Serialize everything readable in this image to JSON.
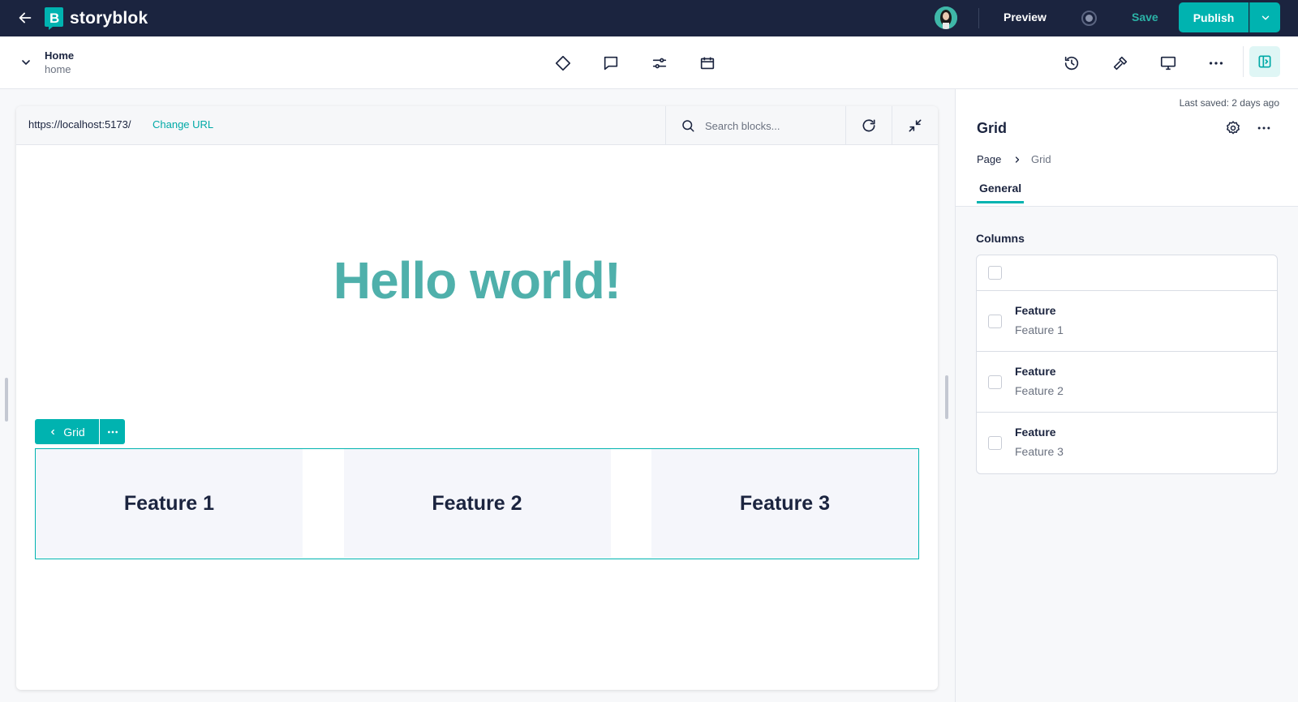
{
  "app": {
    "name": "storyblok"
  },
  "topbar": {
    "preview_label": "Preview",
    "save_label": "Save",
    "publish_label": "Publish"
  },
  "story": {
    "name": "Home",
    "slug": "home"
  },
  "urlbar": {
    "url": "https://localhost:5173/",
    "change_url_label": "Change URL",
    "search_placeholder": "Search blocks..."
  },
  "canvas": {
    "hero_title": "Hello world!",
    "grid_label": "Grid",
    "features": [
      "Feature 1",
      "Feature 2",
      "Feature 3"
    ]
  },
  "panel": {
    "last_saved": "Last saved: 2 days ago",
    "title": "Grid",
    "breadcrumb": [
      "Page",
      "Grid"
    ],
    "tab": "General",
    "columns_label": "Columns",
    "columns": [
      {
        "type": "Feature",
        "name": "Feature 1"
      },
      {
        "type": "Feature",
        "name": "Feature 2"
      },
      {
        "type": "Feature",
        "name": "Feature 3"
      }
    ]
  },
  "colors": {
    "topbar_bg": "#1b243f",
    "accent": "#00b3b0",
    "hero_text": "#4fb0ab"
  },
  "icons": {
    "toolbar_center": [
      "diamond-icon",
      "comment-icon",
      "settings-sliders-icon",
      "calendar-icon"
    ],
    "toolbar_right": [
      "history-icon",
      "tools-icon",
      "desktop-icon",
      "more-icon",
      "panel-toggle-icon"
    ]
  }
}
